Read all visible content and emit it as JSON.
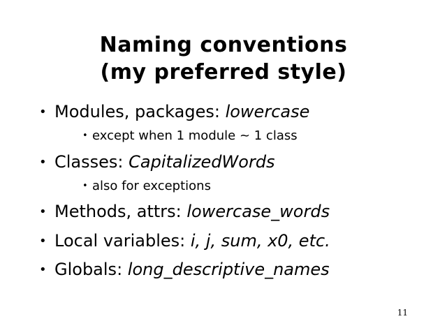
{
  "slide": {
    "title_line1": "Naming conventions",
    "title_line2": "(my preferred style)",
    "bullets": [
      {
        "label": "Modules, packages: ",
        "value": "lowercase"
      },
      {
        "label": "Classes: ",
        "value": "CapitalizedWords"
      },
      {
        "label": "Methods, attrs: ",
        "value": "lowercase_words"
      },
      {
        "label": "Local variables: ",
        "value": "i, j, sum, x0, etc."
      },
      {
        "label": "Globals: ",
        "value": "long_descriptive_names"
      }
    ],
    "subbullets": [
      {
        "text": "except when 1 module ~ 1 class"
      },
      {
        "text": "also for exceptions"
      }
    ],
    "bullet_glyph": "•",
    "page_number": "11"
  }
}
